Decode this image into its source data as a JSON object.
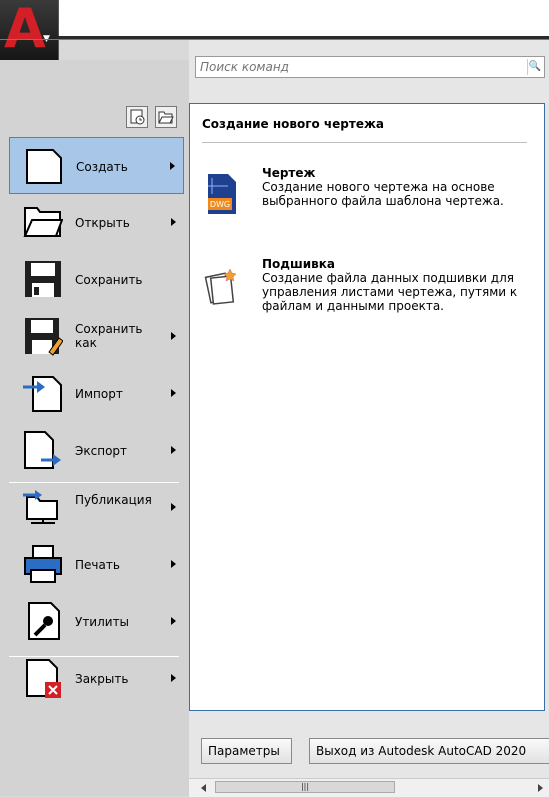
{
  "app": {
    "logo_letter": "A",
    "brand_color": "#d31f26"
  },
  "search": {
    "placeholder": "Поиск команд"
  },
  "menu": {
    "items": [
      {
        "id": "new",
        "label": "Создать",
        "has_submenu": true,
        "selected": true,
        "icon": "new-document-icon"
      },
      {
        "id": "open",
        "label": "Открыть",
        "has_submenu": true,
        "icon": "open-folder-icon"
      },
      {
        "id": "save",
        "label": "Сохранить",
        "has_submenu": false,
        "icon": "save-disk-icon"
      },
      {
        "id": "saveas",
        "label": "Сохранить как",
        "has_submenu": true,
        "icon": "save-as-icon"
      },
      {
        "id": "import",
        "label": "Импорт",
        "has_submenu": true,
        "icon": "import-icon"
      },
      {
        "id": "export",
        "label": "Экспорт",
        "has_submenu": true,
        "icon": "export-icon"
      },
      {
        "id": "publish",
        "label": "Публикация",
        "has_submenu": true,
        "icon": "publish-icon"
      },
      {
        "id": "print",
        "label": "Печать",
        "has_submenu": true,
        "icon": "printer-icon"
      },
      {
        "id": "utilities",
        "label": "Утилиты",
        "has_submenu": true,
        "icon": "wrench-icon"
      },
      {
        "id": "close",
        "label": "Закрыть",
        "has_submenu": true,
        "icon": "close-document-icon"
      }
    ]
  },
  "panel": {
    "title": "Создание нового чертежа",
    "entries": [
      {
        "title": "Чертеж",
        "description": "Создание нового чертежа на основе выбранного файла шаблона чертежа.",
        "icon": "dwg-file-icon",
        "icon_badge": "DWG"
      },
      {
        "title": "Подшивка",
        "description": "Создание файла данных подшивки для управления листами чертежа, путями к файлам и данными проекта.",
        "icon": "sheet-set-icon"
      }
    ]
  },
  "footer": {
    "options_label": "Параметры",
    "exit_label": "Выход из Autodesk AutoCAD 2020"
  },
  "colors": {
    "accent": "#4f81bd",
    "selected_bg": "#a8c7e8",
    "panel_border": "#3a6ea5"
  }
}
